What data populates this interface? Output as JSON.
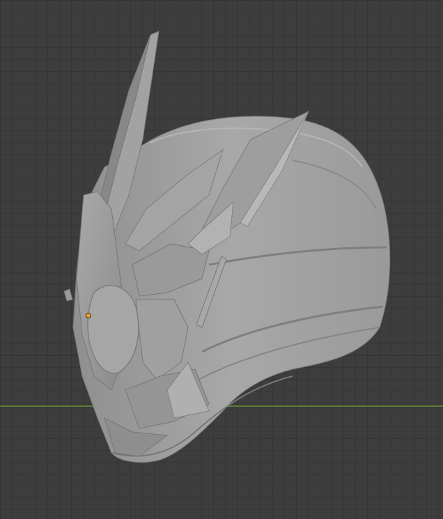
{
  "app": "3D viewport",
  "viewport": {
    "background_color": "#3d3d3d",
    "grid_color": "#363636",
    "x_axis_color": "#5b7a32"
  },
  "model": {
    "description_icon": "helmet-mesh",
    "base_color": "#9c9c9c",
    "origin_color": "#f0a030"
  }
}
